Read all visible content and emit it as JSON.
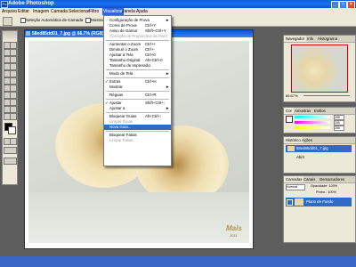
{
  "app": {
    "title": "Adobe Photoshop"
  },
  "window_controls": {
    "minimize": "_",
    "maximize": "□",
    "close": "×"
  },
  "menubar": [
    "Arquivo",
    "Editar",
    "Imagem",
    "Camada",
    "Selecionar",
    "Filtro",
    "Visualizar",
    "Janela",
    "Ajuda"
  ],
  "options_bar": {
    "auto_select": "Seleção Automática de Camada",
    "show_bounds": "Mostrar C"
  },
  "document": {
    "title": "58ed85dd01_7.jpg @ 66.7% (RGB)"
  },
  "watermark": {
    "line1": "Mais",
    "line2": "2011"
  },
  "view_menu": [
    {
      "label": "Configuração de Prova",
      "arrow": "►"
    },
    {
      "label": "Cores de Prova",
      "shortcut": "Ctrl+Y"
    },
    {
      "label": "Aviso de Gamut",
      "shortcut": "Shift+Ctrl+Y"
    },
    {
      "label": "Correção de Proporções de Pixel",
      "disabled": true
    },
    {
      "sep": true
    },
    {
      "label": "Aumentar o Zoom",
      "shortcut": "Ctrl++"
    },
    {
      "label": "Diminuir o Zoom",
      "shortcut": "Ctrl+-"
    },
    {
      "label": "Ajustar à Tela",
      "shortcut": "Ctrl+0"
    },
    {
      "label": "Tamanho Original",
      "shortcut": "Alt+Ctrl+0"
    },
    {
      "label": "Tamanho de Impressão"
    },
    {
      "sep": true
    },
    {
      "label": "Modo de Tela",
      "arrow": "►"
    },
    {
      "sep": true
    },
    {
      "label": "Extras",
      "shortcut": "Ctrl+H",
      "check": "✓"
    },
    {
      "label": "Mostrar",
      "arrow": "►"
    },
    {
      "sep": true
    },
    {
      "label": "Réguas",
      "shortcut": "Ctrl+R"
    },
    {
      "sep": true
    },
    {
      "label": "Ajustar",
      "shortcut": "Shift+Ctrl+;",
      "check": "✓"
    },
    {
      "label": "Ajustar a",
      "arrow": "►"
    },
    {
      "sep": true
    },
    {
      "label": "Bloquear Guias",
      "shortcut": "Alt+Ctrl+;"
    },
    {
      "label": "Limpar Guias",
      "disabled": true
    },
    {
      "label": "Nova Guia...",
      "highlighted": true
    },
    {
      "sep": true
    },
    {
      "label": "Bloquear Fatias"
    },
    {
      "label": "Limpar Fatias",
      "disabled": true
    }
  ],
  "navigator_panel": {
    "tabs": [
      "Navegador",
      "Info",
      "Histograma"
    ],
    "zoom": "66.67%"
  },
  "color_panel": {
    "tabs": [
      "Cor",
      "Amostras",
      "Estilos"
    ],
    "r": "255",
    "g": "255",
    "b": "255"
  },
  "history_panel": {
    "tabs": [
      "Histórico",
      "Ações"
    ],
    "item": "58ed85dd01_7.jpg",
    "step": "Abrir"
  },
  "layers_panel": {
    "tabs": [
      "Camadas",
      "Canais",
      "Demarcadores"
    ],
    "mode": "Normal",
    "opacity": "Opacidade: 100%",
    "fill": "Preen.: 100%",
    "layer": "Plano de Fundo"
  },
  "colors": {
    "titlebar": "#1e6ff0",
    "menu_highlight": "#316ac5",
    "panel_bg": "#ece9d8"
  }
}
